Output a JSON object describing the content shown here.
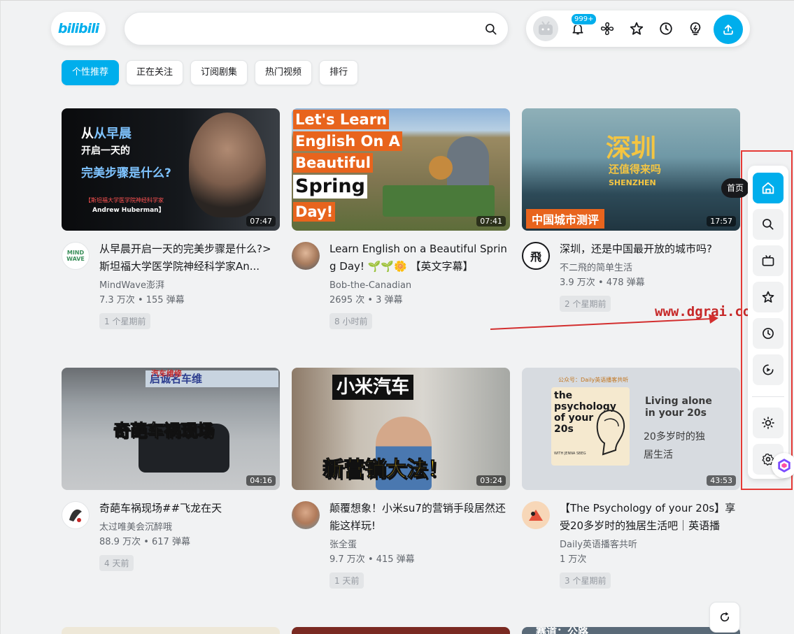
{
  "header": {
    "logo_text": "bilibili",
    "search_placeholder": "",
    "notification_badge": "999+"
  },
  "tabs": [
    "个性推荐",
    "正在关注",
    "订阅剧集",
    "热门视频",
    "排行"
  ],
  "videos": [
    {
      "duration": "07:47",
      "thumb_lines": [
        "从早晨",
        "开启一天的",
        "完美步骤是什么?",
        "【斯坦福大学医学院神经科学家",
        "Andrew Huberman】"
      ],
      "title": "从早晨开启一天的完美步骤是什么?>斯坦福大学医学院神经科学家An...",
      "author": "MindWave澎湃",
      "author_avatar_text": "MIND WAVE",
      "stats": "7.3 万次 • 155 弹幕",
      "time": "1 个星期前"
    },
    {
      "duration": "07:41",
      "thumb_lines": [
        "Let's Learn",
        "English On A",
        "Beautiful",
        "Spring",
        "Day!"
      ],
      "title": "Learn English on a Beautiful Spring Day! 🌱🌱🌼 【英文字幕】",
      "author": "Bob-the-Canadian",
      "author_avatar_text": "",
      "stats": "2695 次 • 3 弹幕",
      "time": "8 小时前"
    },
    {
      "duration": "17:57",
      "thumb_lines": [
        "深圳",
        "还值得来吗",
        "SHENZHEN",
        "中国城市测评"
      ],
      "title": "深圳，还是中国最开放的城市吗?",
      "author": "不二飛的简单生活",
      "author_avatar_text": "飛",
      "stats": "3.9 万次 • 478 弹幕",
      "time": "2 个星期前"
    },
    {
      "duration": "04:16",
      "thumb_lines": [
        "奇葩车祸现场",
        "汽车维修",
        "启诚名车维"
      ],
      "title": "奇葩车祸现场##飞龙在天",
      "author": "太过唯美会沉醉哦",
      "author_avatar_text": "",
      "stats": "88.9 万次 • 617 弹幕",
      "time": "4 天前"
    },
    {
      "duration": "03:24",
      "thumb_lines": [
        "小米汽车",
        "新营销大法！"
      ],
      "title": "颠覆想象！小米su7的营销手段居然还能这样玩!",
      "author": "张全蛋",
      "author_avatar_text": "",
      "stats": "9.7 万次 • 415 弹幕",
      "time": "1 天前"
    },
    {
      "duration": "43:53",
      "thumb_lines": [
        "公众号：Daily英语播客共听",
        "the psychology of your 20s",
        "WITH JENNA SBEG",
        "Living alone in your 20s",
        "20多岁时的独居生活"
      ],
      "title": "【The Psychology of your 20s】享受20多岁时的独居生活吧｜英语播客...",
      "author": "Daily英语播客共听",
      "author_avatar_text": "",
      "stats": "1 万次",
      "time": "3 个星期前"
    }
  ],
  "peek_text": "赛道：公路",
  "sidebar": {
    "home_tooltip": "首页",
    "items": [
      "home-icon",
      "search-icon",
      "tv-icon",
      "star-icon",
      "clock-icon",
      "play-icon",
      "sun-icon",
      "settings-icon"
    ]
  },
  "watermark": "www.dgrai.com",
  "colors": {
    "accent": "#00aeec",
    "highlight_box": "#e53935"
  }
}
